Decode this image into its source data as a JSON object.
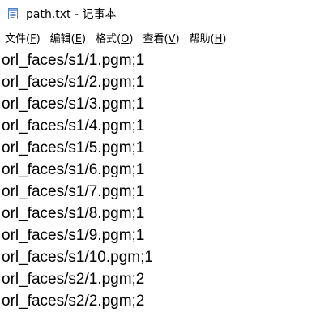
{
  "window": {
    "title": "path.txt - 记事本"
  },
  "menu": [
    {
      "name": "文件",
      "key": "F"
    },
    {
      "name": "编辑",
      "key": "E"
    },
    {
      "name": "格式",
      "key": "O"
    },
    {
      "name": "查看",
      "key": "V"
    },
    {
      "name": "帮助",
      "key": "H"
    }
  ],
  "editor": {
    "lines": [
      "orl_faces/s1/1.pgm;1",
      "orl_faces/s1/2.pgm;1",
      "orl_faces/s1/3.pgm;1",
      "orl_faces/s1/4.pgm;1",
      "orl_faces/s1/5.pgm;1",
      "orl_faces/s1/6.pgm;1",
      "orl_faces/s1/7.pgm;1",
      "orl_faces/s1/8.pgm;1",
      "orl_faces/s1/9.pgm;1",
      "orl_faces/s1/10.pgm;1",
      "orl_faces/s2/1.pgm;2",
      "orl_faces/s2/2.pgm;2"
    ]
  },
  "icons": {
    "app": "notepad-icon"
  }
}
